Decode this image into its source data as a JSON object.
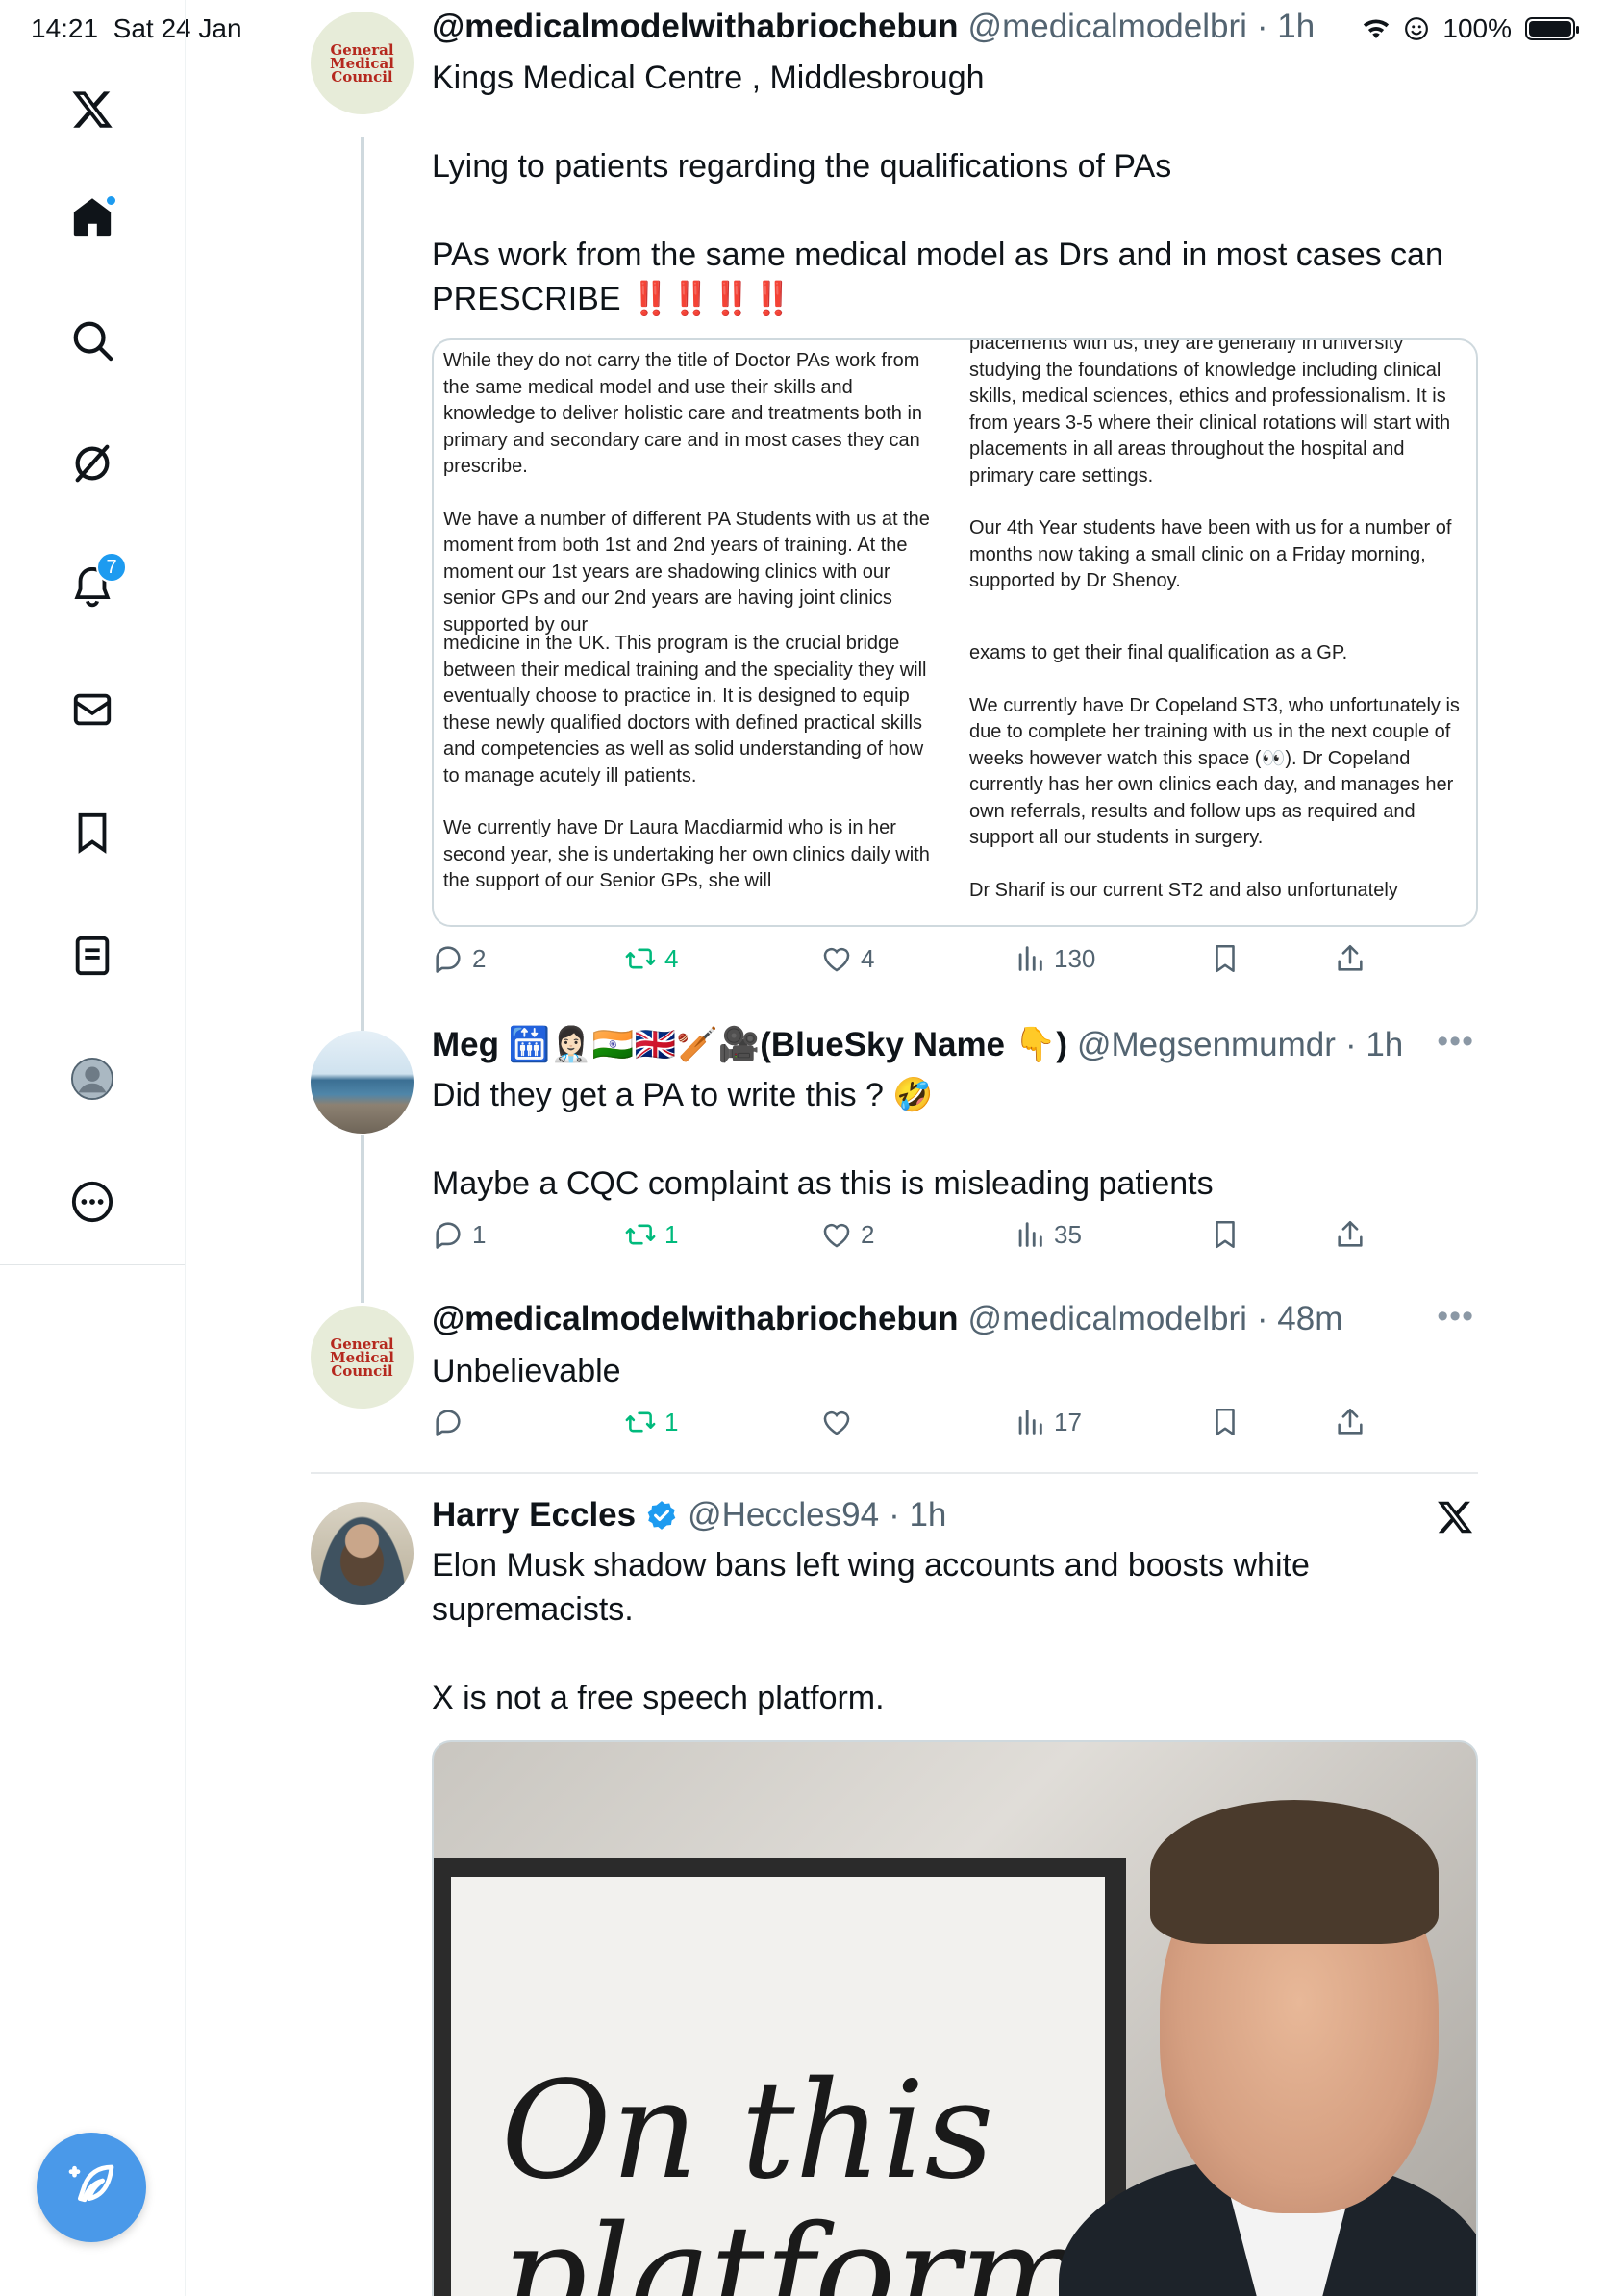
{
  "status_bar": {
    "time": "14:21",
    "date": "Sat 24 Jan",
    "battery": "100%"
  },
  "sidebar": {
    "items": [
      "x-logo",
      "home",
      "search",
      "grok",
      "notifications",
      "messages",
      "bookmarks",
      "lists",
      "profile",
      "more"
    ],
    "notification_count": "7"
  },
  "tweets": [
    {
      "display_name": "@medicalmodelwithabriochebun",
      "handle": "@medicalmodelbri",
      "time": "· 1h",
      "avatar_text": "General Medical Council",
      "paragraphs": [
        "Kings Medical Centre , Middlesbrough",
        "Lying to patients regarding the qualifications of PAs",
        "PAs work from the same medical model as Drs and in most cases can PRESCRIBE"
      ],
      "emoji": "‼️‼️‼️‼️",
      "doc": {
        "left_top": [
          "While they do not carry the title of Doctor PAs work from the same medical model and use their skills and knowledge to deliver holistic care and treatments both in primary and secondary care and in most cases they can prescribe.",
          "We have a number of different PA Students with us at the moment from both 1st and 2nd years of training. At the moment our 1st years are shadowing clinics with our senior GPs and our 2nd years are having joint clinics supported by our"
        ],
        "left_bottom": [
          "medicine in the UK. This program is the crucial bridge between their medical training and the speciality they will eventually choose to practice in. It is designed to equip these newly qualified doctors with defined practical skills and competencies as well as solid understanding of how to manage acutely ill patients.",
          "We currently have Dr Laura Macdiarmid who is in her second year, she is undertaking her own clinics daily with the support of our Senior GPs, she will"
        ],
        "right_top": [
          "placements with us, they are generally in university studying the foundations of knowledge including clinical skills, medical sciences, ethics and professionalism. It is from years 3-5 where their clinical rotations will start with placements in all areas throughout the hospital and primary care settings.",
          "Our 4th Year students have been with us for a number of months now taking a small clinic on a Friday morning, supported by Dr Shenoy."
        ],
        "right_bottom": [
          "exams to get their final qualification as a GP.",
          "We currently have Dr Copeland ST3, who unfortunately is due to complete her training with us in the next couple of weeks however watch this space (👀). Dr Copeland currently has her own clinics each day, and manages her own referrals, results and follow ups as required and support all our students in surgery.",
          "Dr Sharif is our current ST2 and also unfortunately"
        ]
      },
      "replies": "2",
      "reposts": "4",
      "likes": "4",
      "views": "130"
    },
    {
      "display_name": "Meg 🛗👩🏻‍⚕️🇮🇳🇬🇧🏏🎥(BlueSky Name 👇)",
      "handle": "@Megsenmumdr",
      "time": "· 1h",
      "paragraphs": [
        "Did they get a PA to write this ? 🤣",
        "Maybe a CQC complaint as this is misleading patients"
      ],
      "replies": "1",
      "reposts": "1",
      "likes": "2",
      "views": "35"
    },
    {
      "display_name": "@medicalmodelwithabriochebun",
      "handle": "@medicalmodelbri",
      "time": "· 48m",
      "avatar_text": "General Medical Council",
      "paragraphs": [
        "Unbelievable"
      ],
      "replies": "",
      "reposts": "1",
      "likes": "",
      "views": "17"
    },
    {
      "display_name": "Harry Eccles",
      "handle": "@Heccles94",
      "time": "· 1h",
      "paragraphs": [
        "Elon Musk shadow bans left wing accounts and boosts white supremacists.",
        "X is not a free speech platform."
      ],
      "image_text": "On this platform"
    }
  ],
  "colors": {
    "accent": "#1d9bf0",
    "repost": "#00ba7c",
    "text": "#0f1419",
    "muted": "#536471"
  }
}
